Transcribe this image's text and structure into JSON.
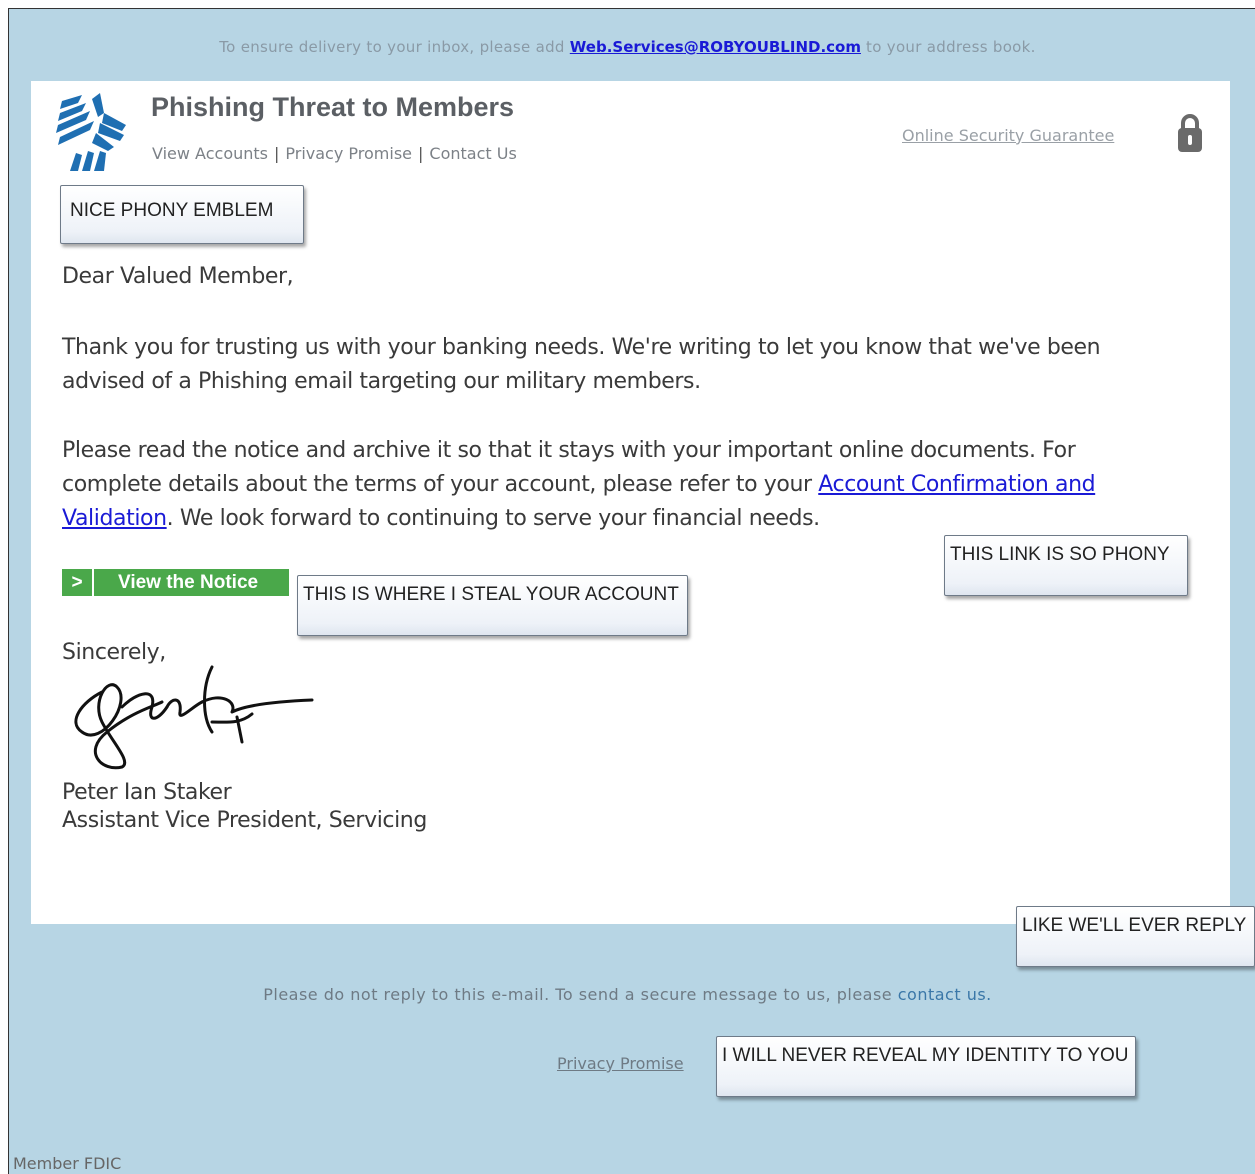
{
  "header": {
    "delivery_prefix": "To ensure delivery to your inbox, please add ",
    "delivery_email": "Web.Services@ROBYOUBLIND.com",
    "delivery_suffix": " to your address book."
  },
  "brand": {
    "title": "Phishing Threat to Members",
    "nav": [
      "View Accounts",
      "Privacy Promise",
      "Contact Us"
    ],
    "security_link": "Online Security Guarantee",
    "lock_icon": "lock-icon"
  },
  "callouts": {
    "emblem": "NICE PHONY EMBLEM",
    "link": "THIS LINK IS SO PHONY",
    "account": "THIS IS WHERE I STEAL YOUR ACCOUNT",
    "reply": "LIKE WE'LL EVER REPLY",
    "identity": "I WILL NEVER REVEAL MY IDENTITY TO YOU"
  },
  "letter": {
    "greeting": "Dear Valued Member,",
    "para1": "Thank you for trusting us with your banking needs. We're writing to let you know that we've been advised of a Phishing email targeting our military members.",
    "para2_a": "Please read the notice and archive it so that it stays with your important online documents. For complete details about the terms of your account, please refer to your ",
    "para2_link": "Account Confirmation and Validation",
    "para2_b": ". We look forward to continuing to serve your financial needs.",
    "button_arrow": ">",
    "button_label": "View the Notice",
    "closing": "Sincerely,",
    "signer_name": "Peter Ian Staker",
    "signer_title": "Assistant Vice President, Servicing"
  },
  "footer": {
    "no_reply": "Please do not reply to this e-mail. To send a secure message to us, please ",
    "contact_link": "contact us.",
    "privacy": "Privacy Promise",
    "fdic": "Member FDIC"
  },
  "colors": {
    "background": "#b7d5e4",
    "button": "#4aa84a",
    "link": "#1a1ad6"
  }
}
